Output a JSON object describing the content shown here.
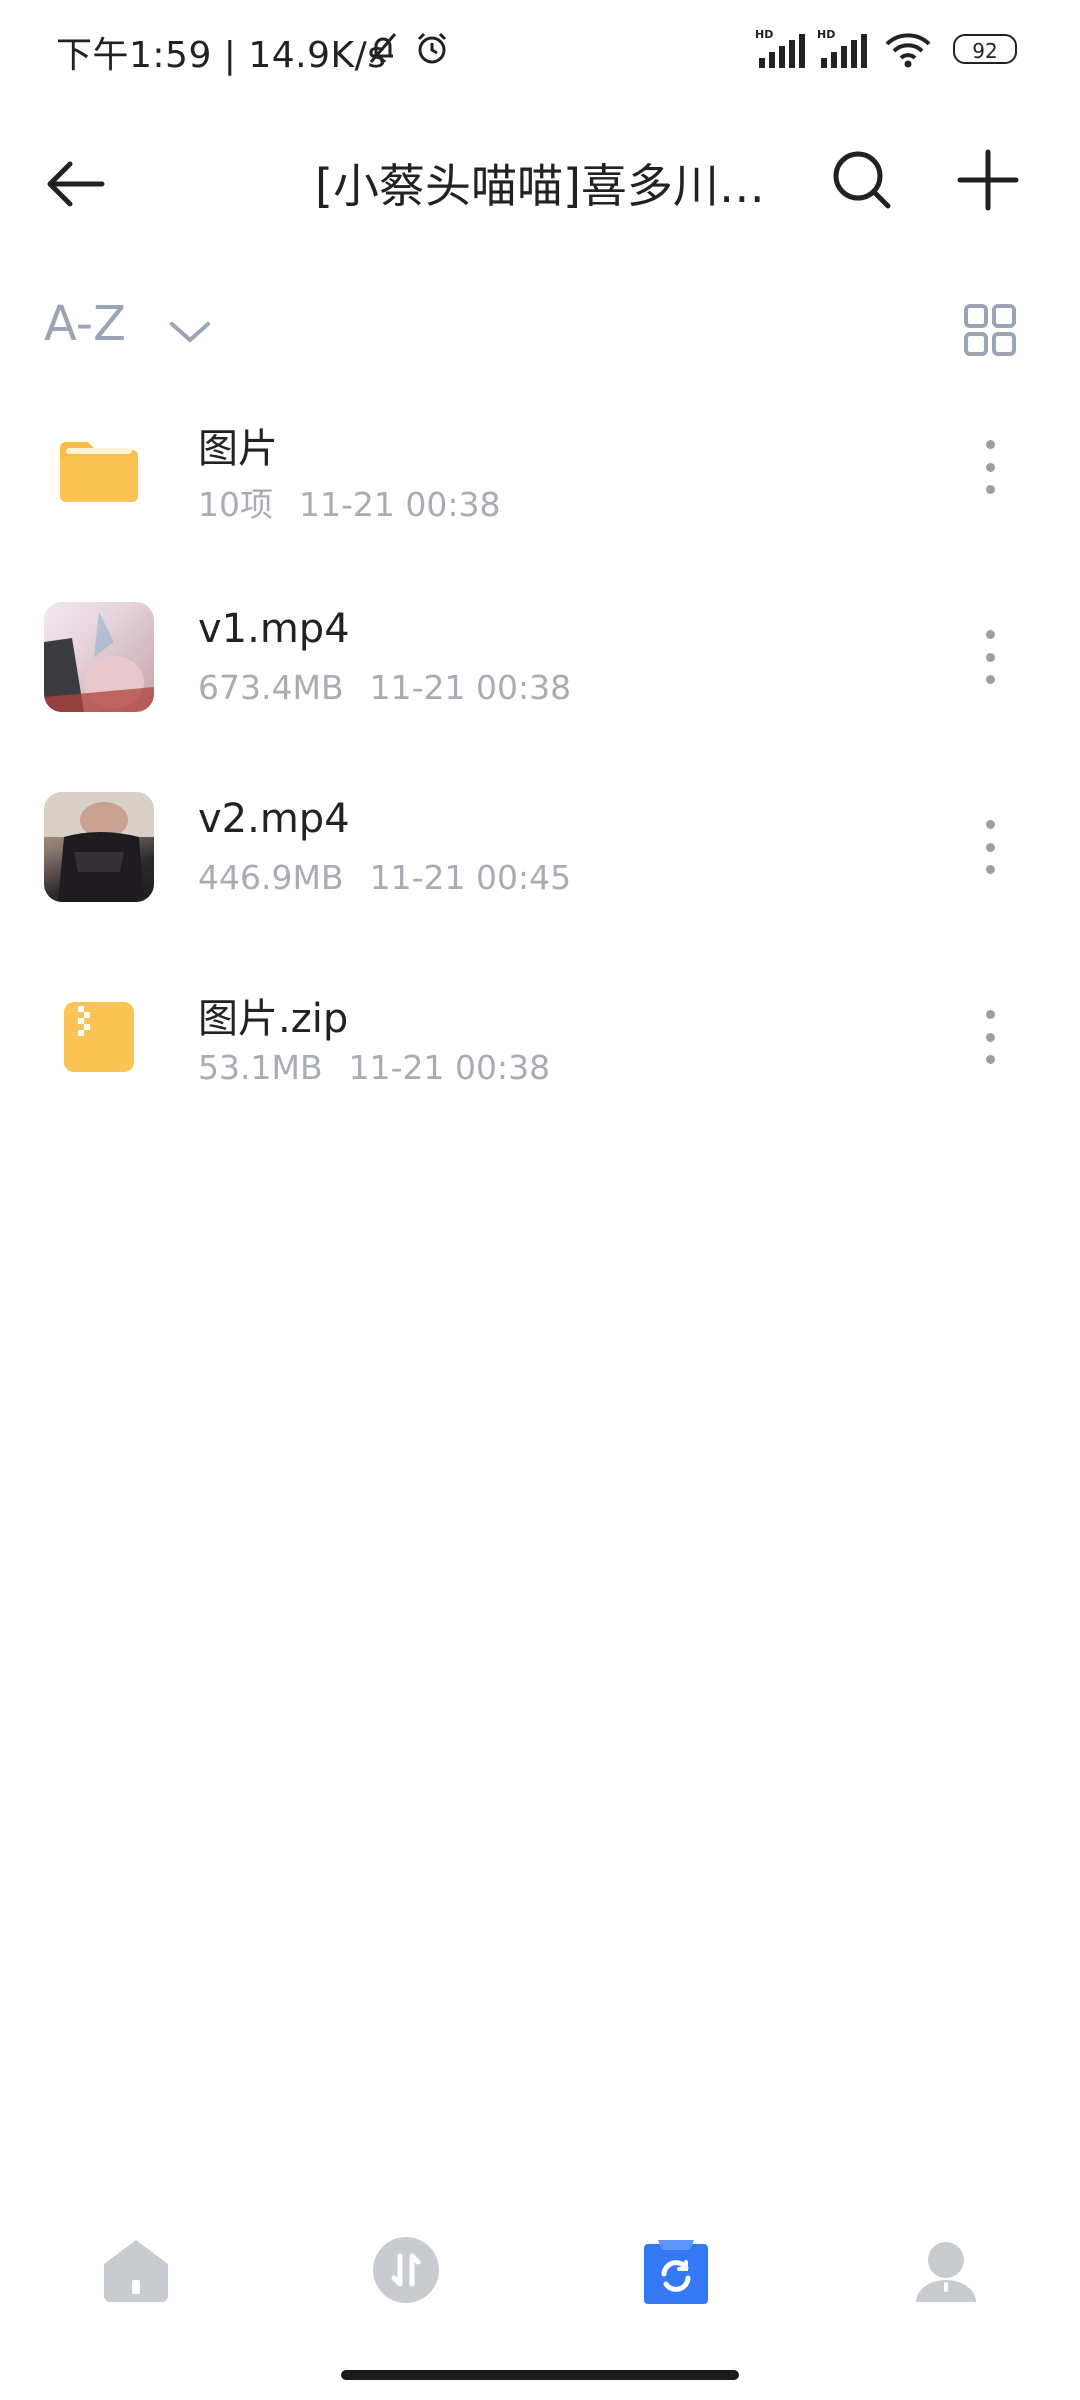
{
  "status_bar": {
    "time_and_speed": "下午1:59 | 14.9K/s",
    "battery": "92"
  },
  "header": {
    "title": "[小蔡头喵喵]喜多川…"
  },
  "sort": {
    "label": "A-Z"
  },
  "files": [
    {
      "name": "图片",
      "meta_size": "10项",
      "meta_date": "11-21 00:38",
      "icon": "folder-icon"
    },
    {
      "name": "v1.mp4",
      "meta_size": "673.4MB",
      "meta_date": "11-21 00:38",
      "icon": "video-thumbnail"
    },
    {
      "name": "v2.mp4",
      "meta_size": "446.9MB",
      "meta_date": "11-21 00:45",
      "icon": "video-thumbnail"
    },
    {
      "name": "图片.zip",
      "meta_size": "53.1MB",
      "meta_date": "11-21 00:38",
      "icon": "zip-icon"
    }
  ],
  "bottom_nav": {
    "items": [
      "home-icon",
      "transfer-icon",
      "files-icon",
      "profile-icon"
    ],
    "active_color": "#3478f6"
  },
  "colors": {
    "folder": "#fbbe45",
    "meta_text": "#a9adb3",
    "sort_text": "#9aa6b6"
  }
}
